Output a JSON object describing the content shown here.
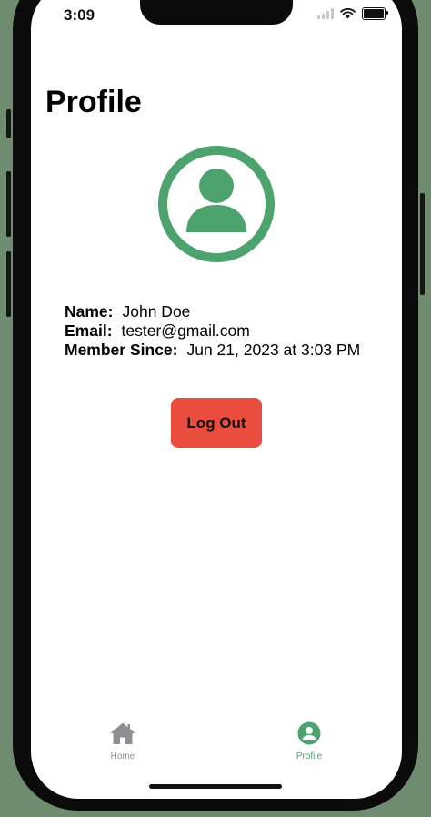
{
  "status_bar": {
    "time": "3:09"
  },
  "profile": {
    "title": "Profile",
    "fields": [
      {
        "label": "Name:",
        "value": "John Doe"
      },
      {
        "label": "Email:",
        "value": "tester@gmail.com"
      },
      {
        "label": "Member Since:",
        "value": "Jun 21, 2023 at 3:03 PM"
      }
    ],
    "logout_label": "Log Out"
  },
  "tabbar": {
    "tabs": [
      {
        "label": "Home",
        "icon": "house-icon",
        "active": false
      },
      {
        "label": "Profile",
        "icon": "person-circle-icon",
        "active": true
      }
    ]
  },
  "colors": {
    "accent": "#4ca36d",
    "logout": "#ea4c3d",
    "inactive_tab": "#8e8e93",
    "background": "#6f8c71"
  }
}
